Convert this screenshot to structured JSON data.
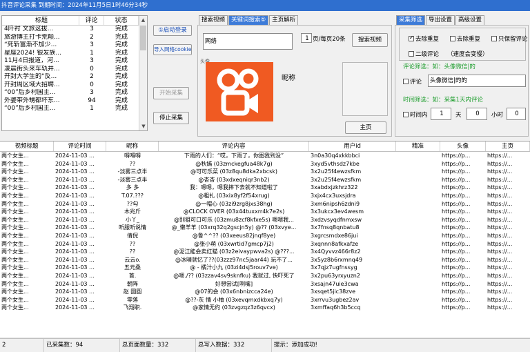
{
  "window": {
    "title": "抖音评论采集  到期时间：2024年11月5日1时46分34秒"
  },
  "task_list": {
    "headers": [
      "标题",
      "评论",
      "状态"
    ],
    "rows": [
      [
        "4阡衬  文旅这拔...",
        "3",
        "完成"
      ],
      [
        "旅游博主打卡荒颠...",
        "2",
        "完成"
      ],
      [
        "“死斩富渐不加少...",
        "3",
        "完成"
      ],
      [
        "星座2024! 银发族...",
        "1",
        "完成"
      ],
      [
        "11月4日报道，河...",
        "3",
        "完成"
      ],
      [
        "凌晨街头来车轨井...",
        "0",
        "完成"
      ],
      [
        "开封大学生的“反...",
        "2",
        "完成"
      ],
      [
        "开封周区域大招聘...",
        "0",
        "完成"
      ],
      [
        "“00”后乡村国主...",
        "3",
        "完成"
      ],
      [
        "外婆带外甥都坏东...",
        "94",
        "完成"
      ],
      [
        "“00”后乡村国主...",
        "1",
        "完成"
      ]
    ]
  },
  "buttons": {
    "start": "①启动登录",
    "import_cookie": "导入网络cookie",
    "start_collect": "开始采集",
    "stop_collect": "停止采集",
    "search_video": "搜索视频",
    "home": "主页"
  },
  "mid_tabs": [
    "搜索视频",
    "关键词搜索⑤",
    "主页解析"
  ],
  "mid": {
    "keyword_value": "网络",
    "pages_value": "1",
    "pages_label": "页/每页20条",
    "nickname_label": "昵称",
    "avatar_caption": "头像"
  },
  "right_tabs": [
    "采集筛选",
    "导出设置",
    "高级设置"
  ],
  "right": {
    "chk_dedupe": "去除重复",
    "chk_remove_error": "去除重复",
    "chk_keep_only": "只保留评论",
    "chk_second": "二级评论",
    "chk_second_note": "（速度会变慢）",
    "comment_filter_label": "评论筛选：如：头像微信|的",
    "chk_comment": "评论",
    "comment_filter_value": "头像微信|的的",
    "time_filter_label": "时间筛选：如：采集1天内评论",
    "chk_time": "时间内",
    "time_v1": "1",
    "time_u1": "天",
    "time_v2": "0",
    "time_u2": "小时",
    "time_v3": "0"
  },
  "main_table": {
    "headers": [
      "视频标题",
      "评论时间",
      "昵称",
      "评论内容",
      "用户id",
      "精准",
      "头像",
      "主页"
    ],
    "rows": [
      [
        "两个女生...",
        "2024-11-03 ...",
        "嘚嘚嘚",
        "下雨的人们：“哎，下雨了，你图我到没”",
        "3n0a30q4xkkbbci",
        "",
        "https://p...",
        "https://..."
      ],
      [
        "两个女生...",
        "2024-11-03 ...",
        "??",
        "@秋嫣 (03zmckegfua48k7g)",
        "3xyd5vthsdz7kbe",
        "",
        "https://p...",
        "https://..."
      ],
      [
        "两个女生...",
        "2024-11-03 ...",
        "-淡雾三点半",
        "@可可乐菜 (03z8qu8dka2xbcsk)",
        "3x2u25f4ewzsfkm",
        "",
        "https://p...",
        "https://..."
      ],
      [
        "两个女生...",
        "2024-11-03 ...",
        "-淡雾三点半",
        "@杏杏 (03xdxeqniqr3nb2)",
        "3x2u25f4ewzsfkm",
        "",
        "https://p...",
        "https://..."
      ],
      [
        "两个女生...",
        "2024-11-03 ...",
        "多 多",
        "我：嗯嗯，嗯我摔下去就不知道啦了",
        "3xabdxjzkhrz322",
        "",
        "https://p...",
        "https://..."
      ],
      [
        "两个女生...",
        "2024-11-03 ...",
        "T.07.???",
        "@粗扎 (03xix8yf2f54xrug)",
        "3xjx4cx3uxsjdra",
        "",
        "https://p...",
        "https://..."
      ],
      [
        "两个女生...",
        "2024-11-03 ...",
        "??勾",
        "@一帽心 (03zi9zrg8jxs38hg)",
        "3xm6nipsh6zdni9",
        "",
        "https://p...",
        "https://..."
      ],
      [
        "两个女生...",
        "2024-11-03 ...",
        "木兆斤",
        "@CLOCK OVER (03x44tuxxrr4k7e2s)",
        "3x3ukcx3ev4wesm",
        "",
        "https://p...",
        "https://..."
      ],
      [
        "两个女生...",
        "2024-11-03 ...",
        "小丫_",
        "@别狙可口可乐 (03zmu8zcf8kfxe5s) 嗯嗯我...",
        "3xdzvsyqdfnmxsw",
        "",
        "https://p...",
        "https://..."
      ],
      [
        "两个女生...",
        "2024-11-03 ...",
        "听服听说情",
        "@_懒羊羊 (03xrq32q2gscjn5y) @?? (03xvye...",
        "3x7fnsq8qnbatu8",
        "",
        "https://p...",
        "https://..."
      ],
      [
        "两个女生...",
        "2024-11-03 ...",
        "倩倪",
        "@鲁^^?? (03xeeus82jnqf8ye)",
        "3xgrcsmdxe86jui",
        "",
        "https://p...",
        "https://..."
      ],
      [
        "两个女生...",
        "2024-11-03 ...",
        "??",
        "@张小萌 (03xwrtid7gmcp7j2)",
        "3xqnnn8afkxafze",
        "",
        "https://p...",
        "https://..."
      ],
      [
        "两个女生...",
        "2024-11-03 ...",
        "??",
        "@泥江能会卖红猫 (03z2eivaypwva2s) @???...",
        "3x4Qyvvz466r8z2",
        "",
        "https://p...",
        "https://..."
      ],
      [
        "两个女生...",
        "2024-11-03 ...",
        "云云o.",
        "@冰晴就忆了??(03zzz97nc5jaar44) 玩不了...",
        "3x5yz8b6rxmnq49",
        "",
        "https://p...",
        "https://..."
      ],
      [
        "两个女生...",
        "2024-11-03 ...",
        "五元桑",
        "@ - 橘汁小九 (03zi4dsj5rouv7ve)",
        "3x7qjz7ugfnssyg",
        "",
        "https://p...",
        "https://..."
      ],
      [
        "两个女生...",
        "2024-11-03 ...",
        "首.",
        "@嗯./?? (03zzav4sv9sknfku) 我就过, 快吓死了",
        "3x2pu63yrxyuzn2",
        "",
        "https://p...",
        "https://..."
      ],
      [
        "两个女生...",
        "2024-11-03 ...",
        "朝阵",
        "好想尝试[咧嘴]",
        "3xsajn47uie3cwa",
        "",
        "https://p...",
        "https://..."
      ],
      [
        "两个女生...",
        "2024-11-03 ...",
        "赵 圆圆",
        "@07的会 (03x6nbnizcca24e)",
        "3xsqet5jic38zve",
        "",
        "https://p...",
        "https://..."
      ],
      [
        "两个女生...",
        "2024-11-03 ...",
        "零落",
        "@??-灰 情 小柚 (03xevqmxdkbxq7y)",
        "3xrrvu3ugbez2av",
        "",
        "https://p...",
        "https://..."
      ],
      [
        "两个女生...",
        "2024-11-03 ...",
        "飞翔职.",
        "@家情无约 (03zvgzqz3z6qvcx)",
        "3xmffaq6h3b5ccq",
        "",
        "https://p...",
        "https://..."
      ]
    ]
  },
  "status": {
    "s1": "2",
    "s2": "已采集数：94",
    "s3": "总页面数量：332",
    "s4": "总写入数据：332",
    "s5": "提示：添加成功!"
  },
  "colors": {
    "title_bg": "#2f6fcf",
    "tab_active": "#3d7bd8",
    "logo": "#f05a22",
    "green": "#1a9c2a"
  }
}
